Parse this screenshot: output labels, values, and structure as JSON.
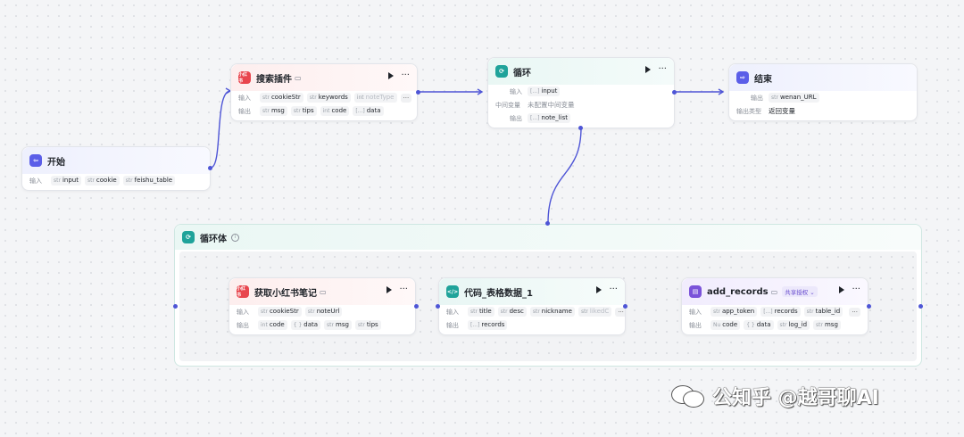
{
  "nodes": {
    "start": {
      "title": "开始",
      "input_label": "输入",
      "inputs": [
        {
          "type": "str",
          "name": "input"
        },
        {
          "type": "str",
          "name": "cookie"
        },
        {
          "type": "str",
          "name": "feishu_table"
        }
      ]
    },
    "search": {
      "title": "搜索插件",
      "input_label": "输入",
      "output_label": "输出",
      "inputs": [
        {
          "type": "str",
          "name": "cookieStr"
        },
        {
          "type": "str",
          "name": "keywords"
        },
        {
          "type": "int",
          "name": "noteType"
        }
      ],
      "outputs": [
        {
          "type": "str",
          "name": "msg"
        },
        {
          "type": "str",
          "name": "tips"
        },
        {
          "type": "int",
          "name": "code"
        },
        {
          "type": "[...]",
          "name": "data"
        }
      ],
      "more": "···"
    },
    "loop": {
      "title": "循环",
      "input_label": "输入",
      "var_label": "中间变量",
      "var_value": "未配置中间变量",
      "output_label": "输出",
      "input": {
        "type": "[...]",
        "name": "input"
      },
      "output": {
        "type": "[...]",
        "name": "note_list"
      }
    },
    "end": {
      "title": "结束",
      "output_label": "输出",
      "output_type_label": "输出类型",
      "output_type_value": "返回变量",
      "output": {
        "type": "str",
        "name": "wenan_URL"
      }
    },
    "loop_body": {
      "title": "循环体",
      "info": "i"
    },
    "fetch_note": {
      "title": "获取小红书笔记",
      "input_label": "输入",
      "output_label": "输出",
      "inputs": [
        {
          "type": "str",
          "name": "cookieStr"
        },
        {
          "type": "str",
          "name": "noteUrl"
        }
      ],
      "outputs": [
        {
          "type": "int",
          "name": "code"
        },
        {
          "type": "{ }",
          "name": "data"
        },
        {
          "type": "str",
          "name": "msg"
        },
        {
          "type": "str",
          "name": "tips"
        }
      ]
    },
    "code_table": {
      "title": "代码_表格数据_1",
      "input_label": "输入",
      "output_label": "输出",
      "inputs": [
        {
          "type": "str",
          "name": "title"
        },
        {
          "type": "str",
          "name": "desc"
        },
        {
          "type": "str",
          "name": "nickname"
        },
        {
          "type": "str",
          "name": "likedC"
        }
      ],
      "outputs": [
        {
          "type": "[...]",
          "name": "records"
        }
      ],
      "more": "···"
    },
    "add_records": {
      "title": "add_records",
      "share": "共享授权 ⌄",
      "input_label": "输入",
      "output_label": "输出",
      "inputs": [
        {
          "type": "str",
          "name": "app_token"
        },
        {
          "type": "[...]",
          "name": "records"
        },
        {
          "type": "str",
          "name": "table_id"
        }
      ],
      "outputs": [
        {
          "type": "Nu",
          "name": "code"
        },
        {
          "type": "{ }",
          "name": "data"
        },
        {
          "type": "str",
          "name": "log_id"
        },
        {
          "type": "str",
          "name": "msg"
        }
      ],
      "more": "···"
    }
  },
  "icons": {
    "plugin_badge": "小红书",
    "loop_badge": "⟳",
    "start_badge": "⇦",
    "end_badge": "⇨",
    "code_badge": "</>",
    "db_badge": "▤"
  },
  "colors": {
    "edge": "#4e55d6",
    "plugin": "#e8464e",
    "loop": "#1fa39a",
    "start": "#5b5ee8",
    "db": "#7a52d9"
  },
  "watermark": {
    "text": "公知乎 @越哥聊AI"
  }
}
